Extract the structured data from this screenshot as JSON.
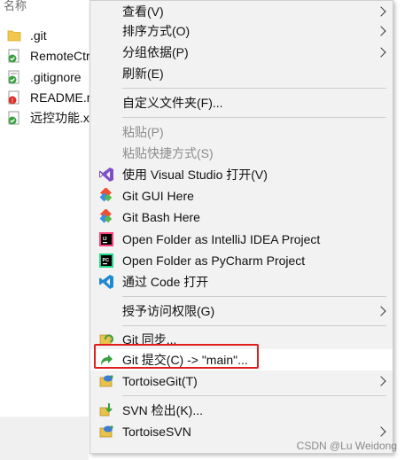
{
  "explorer": {
    "header": "名称",
    "files": [
      {
        "name": ".git",
        "icon": "folder-icon"
      },
      {
        "name": "RemoteCtr",
        "icon": "git-file-icon"
      },
      {
        "name": ".gitignore",
        "icon": "git-file-icon"
      },
      {
        "name": "README.m",
        "icon": "git-modified-icon"
      },
      {
        "name": "远控功能.xr",
        "icon": "git-file-icon"
      }
    ]
  },
  "menu": {
    "items": [
      {
        "label": "查看(V)"
      },
      {
        "label": "排序方式(O)"
      },
      {
        "label": "分组依据(P)"
      },
      {
        "label": "刷新(E)"
      },
      {
        "label": "自定义文件夹(F)..."
      },
      {
        "label": "粘贴(P)"
      },
      {
        "label": "粘贴快捷方式(S)"
      },
      {
        "label": "使用 Visual Studio 打开(V)"
      },
      {
        "label": "Git GUI Here"
      },
      {
        "label": "Git Bash Here"
      },
      {
        "label": "Open Folder as IntelliJ IDEA Project"
      },
      {
        "label": "Open Folder as PyCharm Project"
      },
      {
        "label": "通过 Code 打开"
      },
      {
        "label": "授予访问权限(G)"
      },
      {
        "label": "Git 同步..."
      },
      {
        "label": "Git 提交(C) -> \"main\"..."
      },
      {
        "label": "TortoiseGit(T)"
      },
      {
        "label": "SVN 检出(K)..."
      },
      {
        "label": "TortoiseSVN"
      }
    ]
  },
  "watermark": "CSDN @Lu Weidong",
  "colors": {
    "highlight_border": "#e01e1e",
    "menu_bg": "#f2f2f2",
    "disabled_text": "#8c8c8c"
  }
}
